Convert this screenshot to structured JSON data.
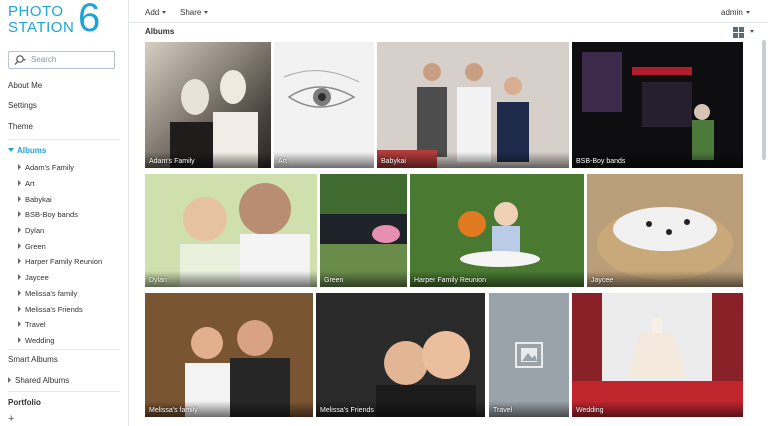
{
  "app": {
    "logo_text_line1": "PHOTO",
    "logo_text_line2": "STATION",
    "logo_number": "6",
    "brand_color": "#1ea4d6"
  },
  "search": {
    "placeholder": "Search",
    "icon": "search-icon"
  },
  "sidebar": {
    "nav": [
      {
        "label": "About Me"
      },
      {
        "label": "Settings"
      },
      {
        "label": "Theme"
      }
    ],
    "albums_header": "Albums",
    "albums": [
      "Adam's Family",
      "Art",
      "Babykai",
      "BSB-Boy bands",
      "Dylan",
      "Green",
      "Harper Family Reunion",
      "Jaycee",
      "Melissa's family",
      "Melissa's Friends",
      "Travel",
      "Wedding"
    ],
    "smart_albums": "Smart Albums",
    "shared_albums": "Shared Albums",
    "portfolio": "Portfolio",
    "add_symbol": "+"
  },
  "toolbar": {
    "add": "Add",
    "share": "Share",
    "user": "admin"
  },
  "main": {
    "title": "Albums",
    "tiles": [
      {
        "label": "Adam's Family"
      },
      {
        "label": "Art"
      },
      {
        "label": "Babykai"
      },
      {
        "label": "BSB-Boy bands"
      },
      {
        "label": "Dylan"
      },
      {
        "label": "Green"
      },
      {
        "label": "Harper Family Reunion"
      },
      {
        "label": "Jaycee"
      },
      {
        "label": "Melissa's family"
      },
      {
        "label": "Melissa's Friends"
      },
      {
        "label": "Travel"
      },
      {
        "label": "Wedding"
      }
    ]
  }
}
